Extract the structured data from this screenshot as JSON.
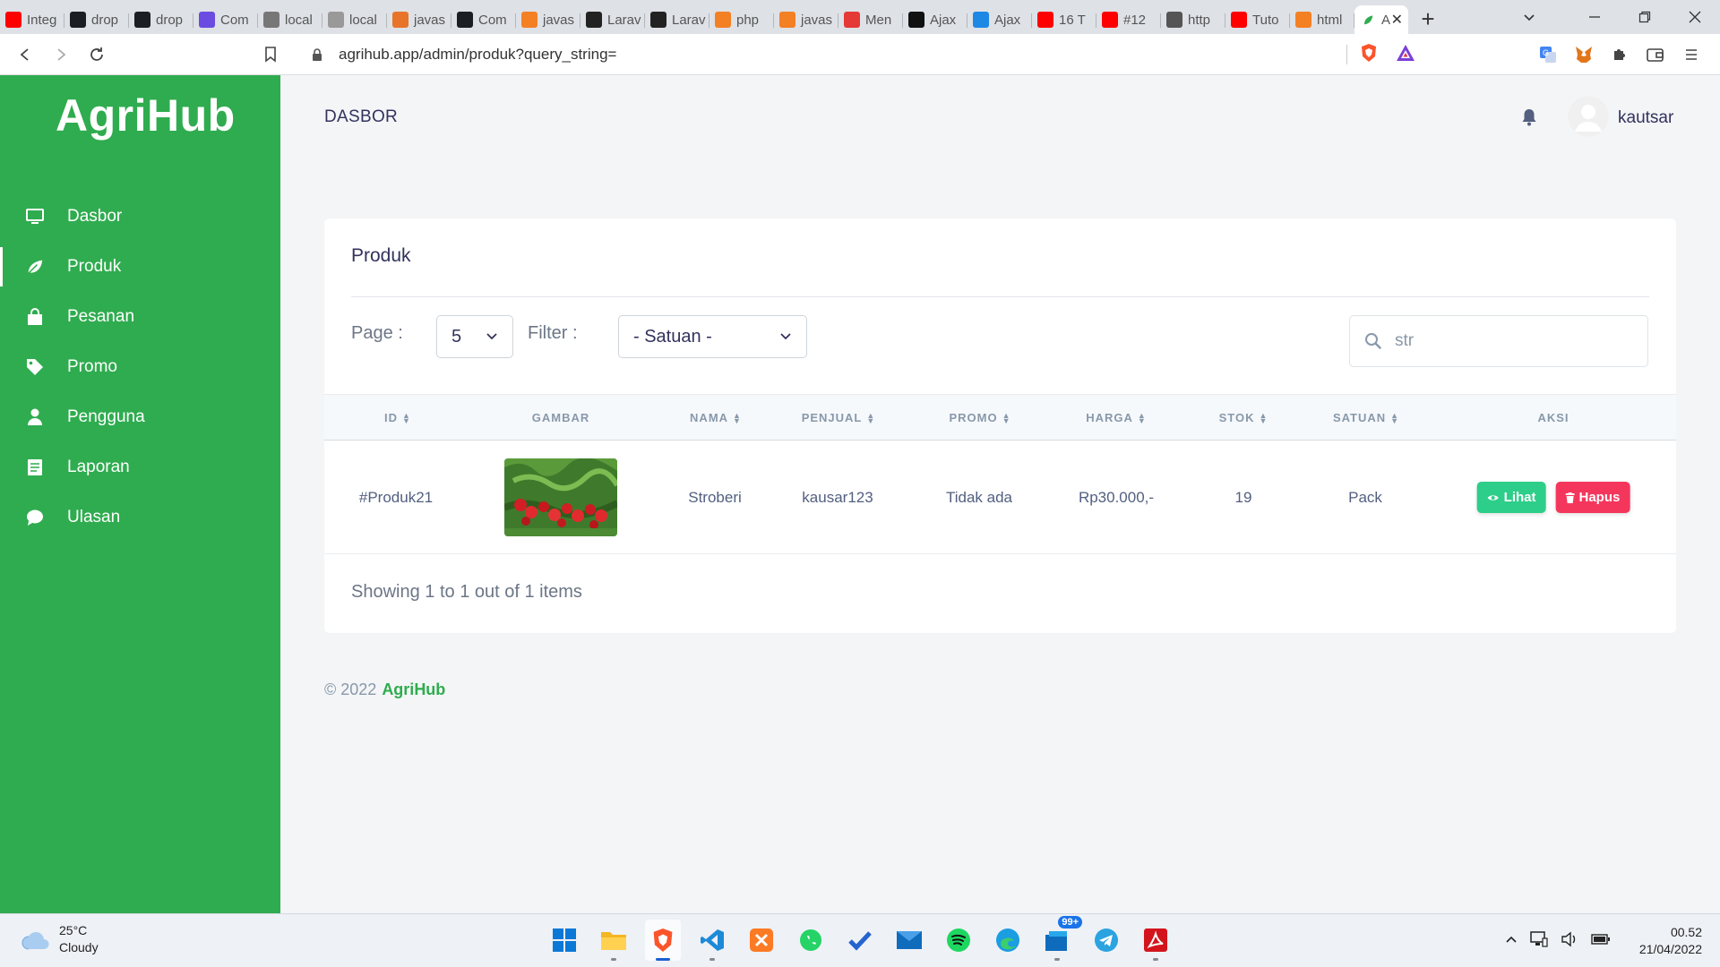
{
  "browser": {
    "tabs": [
      {
        "label": "Integ",
        "favicon": "youtube-icon",
        "color": "#ff0000"
      },
      {
        "label": "drop",
        "favicon": "github-icon",
        "color": "#1b1f23"
      },
      {
        "label": "drop",
        "favicon": "github-icon",
        "color": "#1b1f23"
      },
      {
        "label": "Com",
        "favicon": "d-icon",
        "color": "#6a4ce0"
      },
      {
        "label": "local",
        "favicon": "feather-icon",
        "color": "#777777"
      },
      {
        "label": "local",
        "favicon": "pma-icon",
        "color": "#999999"
      },
      {
        "label": "javas",
        "favicon": "code-icon",
        "color": "#e8742a"
      },
      {
        "label": "Com",
        "favicon": "github-icon",
        "color": "#1b1f23"
      },
      {
        "label": "javas",
        "favicon": "stack-icon",
        "color": "#f48024"
      },
      {
        "label": "Larav",
        "favicon": "tm-icon",
        "color": "#222222"
      },
      {
        "label": "Larav",
        "favicon": "tm-icon",
        "color": "#222222"
      },
      {
        "label": "php",
        "favicon": "stack-icon",
        "color": "#f48024"
      },
      {
        "label": "javas",
        "favicon": "stack-icon",
        "color": "#f48024"
      },
      {
        "label": "Men",
        "favicon": "qa-icon",
        "color": "#e53935"
      },
      {
        "label": "Ajax",
        "favicon": "circle-icon",
        "color": "#111111"
      },
      {
        "label": "Ajax",
        "favicon": "st-icon",
        "color": "#1e88e5"
      },
      {
        "label": "16 T",
        "favicon": "youtube-icon",
        "color": "#ff0000"
      },
      {
        "label": "#12",
        "favicon": "youtube-icon",
        "color": "#ff0000"
      },
      {
        "label": "http",
        "favicon": "grid-icon",
        "color": "#555555"
      },
      {
        "label": "Tuto",
        "favicon": "youtube-icon",
        "color": "#ff0000"
      },
      {
        "label": "html",
        "favicon": "stack-icon",
        "color": "#f48024"
      }
    ],
    "active_tab": {
      "label": "A",
      "favicon": "leaf-icon"
    },
    "url": "agrihub.app/admin/produk?query_string="
  },
  "app": {
    "brand": "AgriHub",
    "accent": "#2fac4f",
    "sidebar": [
      {
        "label": "Dasbor",
        "icon": "monitor-icon"
      },
      {
        "label": "Produk",
        "icon": "leaf-icon",
        "active": true
      },
      {
        "label": "Pesanan",
        "icon": "shopping-bag-icon"
      },
      {
        "label": "Promo",
        "icon": "tag-icon"
      },
      {
        "label": "Pengguna",
        "icon": "user-icon"
      },
      {
        "label": "Laporan",
        "icon": "report-icon"
      },
      {
        "label": "Ulasan",
        "icon": "chat-icon"
      }
    ],
    "topbar": {
      "title": "DASBOR",
      "username": "kautsar"
    },
    "card": {
      "title": "Produk",
      "page_label": "Page :",
      "page_value": "5",
      "filter_label": "Filter :",
      "filter_value": "- Satuan -",
      "search_value": "str",
      "columns": [
        "ID",
        "GAMBAR",
        "NAMA",
        "PENJUAL",
        "PROMO",
        "HARGA",
        "STOK",
        "SATUAN",
        "AKSI"
      ],
      "rows": [
        {
          "id": "#Produk21",
          "nama": "Stroberi",
          "penjual": "kausar123",
          "promo": "Tidak ada",
          "harga": "Rp30.000,-",
          "stok": "19",
          "satuan": "Pack"
        }
      ],
      "btn_view": "Lihat",
      "btn_delete": "Hapus",
      "showing": "Showing 1 to 1 out of 1 items"
    },
    "footer": {
      "copyright": "© 2022",
      "brand": "AgriHub"
    }
  },
  "taskbar": {
    "weather_temp": "25°C",
    "weather_desc": "Cloudy",
    "time": "00.52",
    "date": "21/04/2022",
    "badge": "99+"
  }
}
